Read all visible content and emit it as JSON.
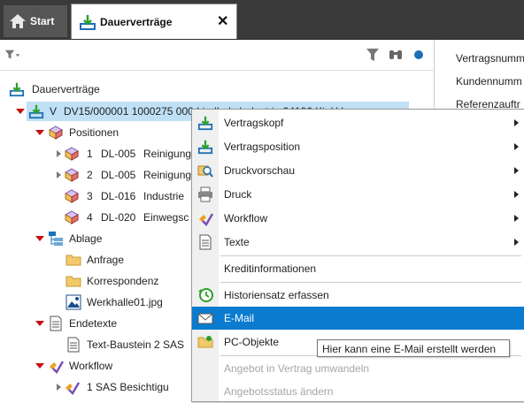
{
  "tabs": {
    "start_label": "Start",
    "active_label": "Dauerverträge",
    "close_glyph": "✕"
  },
  "icons": {
    "home": "home-icon",
    "download": "download-arrow-icon",
    "filter": "filter-icon",
    "binoculars": "binoculars-icon",
    "status": "status-dot-icon"
  },
  "colors": {
    "highlight": "#0b7bd0",
    "selection": "#bfe0f5",
    "expand_arrow": "#c41010",
    "tab_bar": "#3a3a3a"
  },
  "right_panel": {
    "labels": [
      "Vertragsnumm",
      "Kundennumm",
      "Referenzauftr"
    ]
  },
  "tree": {
    "root": "Dauerverträge",
    "contract_prefix": "V",
    "contract": "DV15/000001  1000275  000  Lindholz Industrie  24106 Kiel  V",
    "positionen": "Positionen",
    "positions": [
      {
        "num": "1",
        "code": "DL-005",
        "desc": "Reinigung"
      },
      {
        "num": "2",
        "code": "DL-005",
        "desc": "Reinigung"
      },
      {
        "num": "3",
        "code": "DL-016",
        "desc": "Industrie"
      },
      {
        "num": "4",
        "code": "DL-020",
        "desc": "Einwegsc"
      }
    ],
    "ablage": "Ablage",
    "anfrage": "Anfrage",
    "korrespondenz": "Korrespondenz",
    "werkhalle": "Werkhalle01.jpg",
    "endetexte": "Endetexte",
    "textbaustein": "Text-Baustein 2 SAS",
    "workflow": "Workflow",
    "workflow_item": "1     SAS  Besichtigu"
  },
  "menu": {
    "items": [
      {
        "label": "Vertragskopf",
        "icon": "download-arrow-icon",
        "submenu": true
      },
      {
        "label": "Vertragsposition",
        "icon": "download-arrow-icon",
        "submenu": true
      },
      {
        "label": "Druckvorschau",
        "icon": "print-preview-icon",
        "submenu": true
      },
      {
        "label": "Druck",
        "icon": "printer-icon",
        "submenu": true
      },
      {
        "label": "Workflow",
        "icon": "workflow-icon",
        "submenu": true
      },
      {
        "label": "Texte",
        "icon": "document-icon",
        "submenu": true
      },
      {
        "label": "Kreditinformationen",
        "icon": "",
        "submenu": false
      },
      {
        "label": "Historiensatz erfassen",
        "icon": "history-clock-icon",
        "submenu": false
      },
      {
        "label": "E-Mail",
        "icon": "envelope-icon",
        "submenu": false,
        "highlighted": true
      },
      {
        "label": "PC-Objekte",
        "icon": "folder-link-icon",
        "submenu": false
      },
      {
        "label": "Angebot in Vertrag umwandeln",
        "icon": "",
        "submenu": false,
        "disabled": true
      },
      {
        "label": "Angebotsstatus ändern",
        "icon": "",
        "submenu": false,
        "disabled": true
      }
    ]
  },
  "tooltip": "Hier kann eine E-Mail erstellt werden"
}
